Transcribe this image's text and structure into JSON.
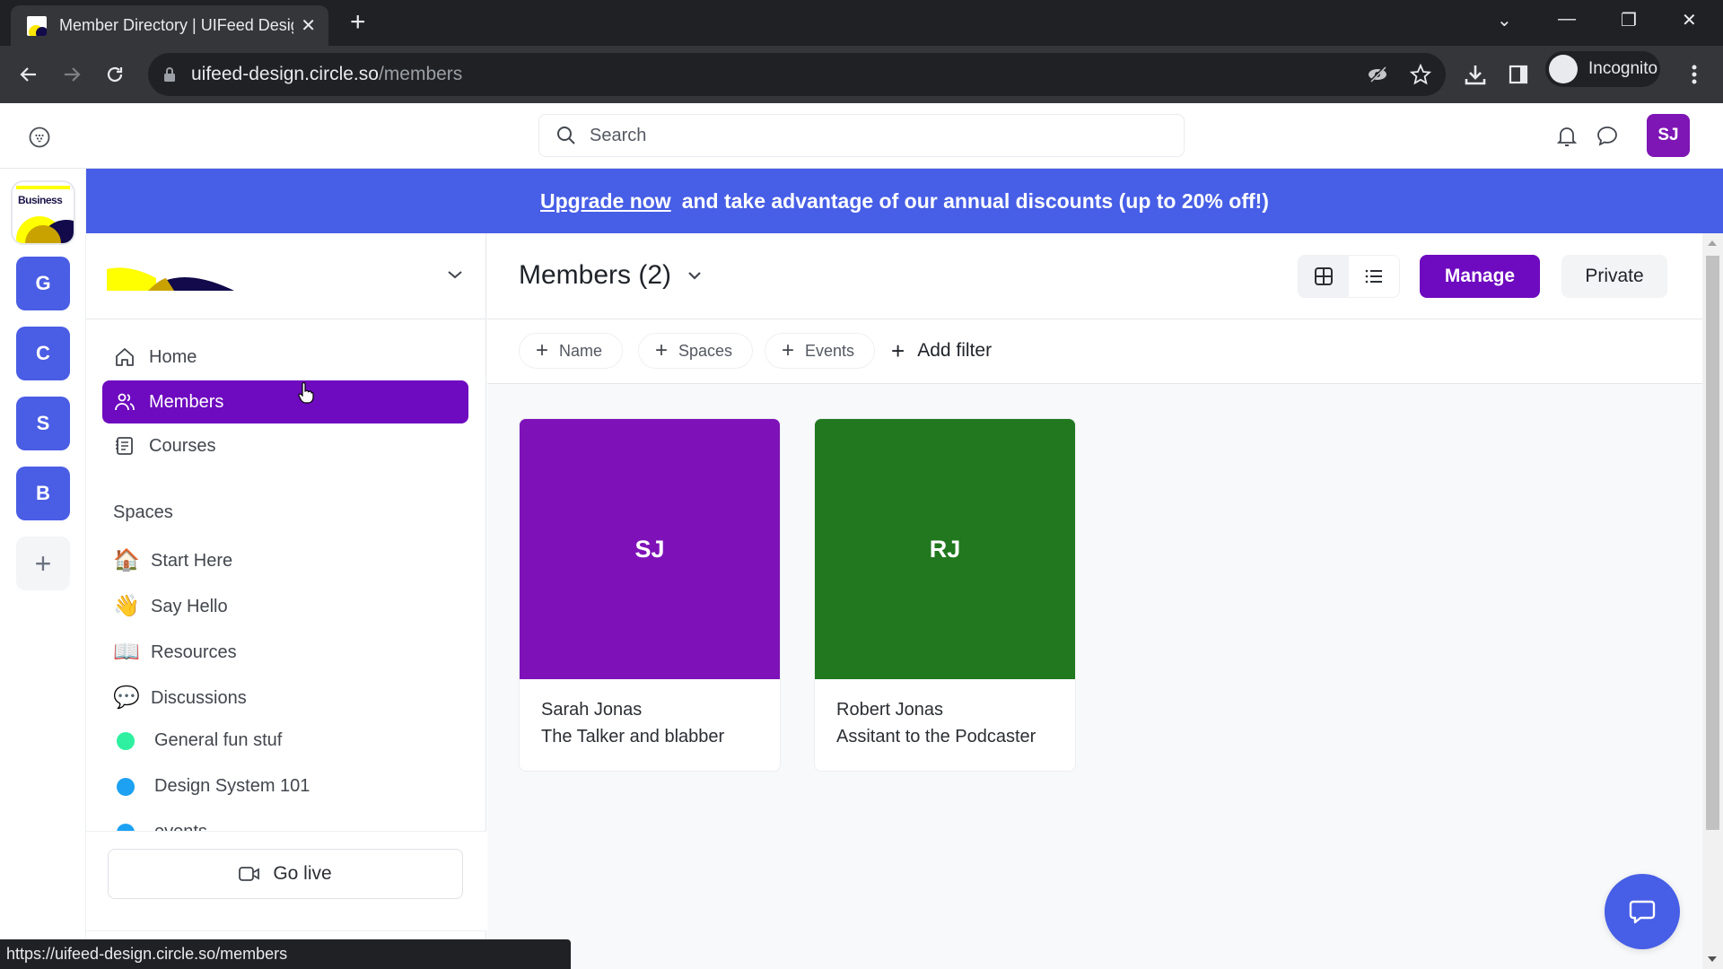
{
  "browser": {
    "tab_title": "Member Directory | UIFeed Design",
    "url_host": "uifeed-design.circle.so",
    "url_path": "/members",
    "profile_label": "Incognito",
    "status_url": "https://uifeed-design.circle.so/members"
  },
  "header": {
    "search_placeholder": "Search",
    "user_initials": "SJ",
    "user_avatar_color": "#7e16b5"
  },
  "banner": {
    "link_text": "Upgrade now",
    "text": "and take advantage of our annual discounts (up to 20% off!)",
    "color": "#475ee6"
  },
  "communities": [
    {
      "label": "Business",
      "type": "logo"
    },
    {
      "label": "G"
    },
    {
      "label": "C"
    },
    {
      "label": "S"
    },
    {
      "label": "B"
    }
  ],
  "sidebar": {
    "nav": [
      {
        "label": "Home",
        "icon": "home-icon"
      },
      {
        "label": "Members",
        "icon": "members-icon",
        "active": true
      },
      {
        "label": "Courses",
        "icon": "courses-icon"
      }
    ],
    "spaces_title": "Spaces",
    "spaces": [
      {
        "label": "Start Here",
        "emoji": "🏠"
      },
      {
        "label": "Say Hello",
        "emoji": "👋"
      },
      {
        "label": "Resources",
        "emoji": "📖"
      },
      {
        "label": "Discussions",
        "emoji": "💬"
      },
      {
        "label": "General fun stuf",
        "dot": "#2ef0a0"
      },
      {
        "label": "Design System 101",
        "dot": "#1da1f2"
      },
      {
        "label": "events",
        "dot": "#1da1f2"
      }
    ],
    "go_live_label": "Go live",
    "accent": "#6e0abf"
  },
  "main": {
    "title": "Members (2)",
    "manage_label": "Manage",
    "private_label": "Private",
    "filters": [
      "Name",
      "Spaces",
      "Events"
    ],
    "add_filter_label": "Add filter",
    "members": [
      {
        "initials": "SJ",
        "name": "Sarah Jonas",
        "headline": "The Talker and blabber",
        "color": "#7e12b8"
      },
      {
        "initials": "RJ",
        "name": "Robert Jonas",
        "headline": "Assitant to the Podcaster",
        "color": "#21781f"
      }
    ]
  }
}
